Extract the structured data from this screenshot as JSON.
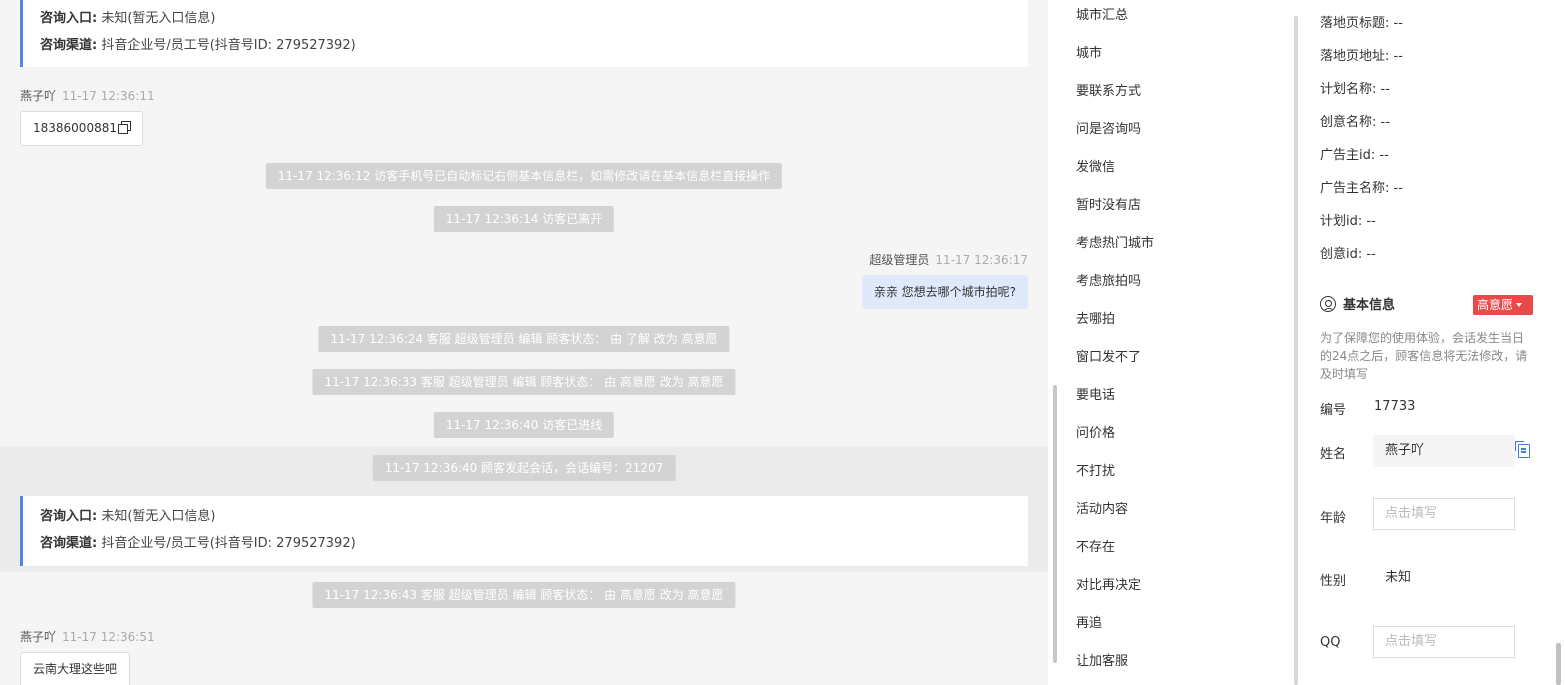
{
  "chat": {
    "info_card_1": {
      "entry_label": "咨询入口:",
      "entry_value": "未知(暂无入口信息)",
      "channel_label": "咨询渠道:",
      "channel_value": "抖音企业号/员工号(抖音号ID: 279527392)"
    },
    "msg_1": {
      "sender": "燕子吖",
      "time": "11-17 12:36:11",
      "text": "18386000881"
    },
    "sys_1": "11-17 12:36:12 访客手机号已自动标记右侧基本信息栏，如需修改请在基本信息栏直接操作",
    "sys_2": "11-17 12:36:14 访客已离开",
    "msg_agent": {
      "sender": "超级管理员",
      "time": "11-17 12:36:17",
      "text": "亲亲 您想去哪个城市拍呢?"
    },
    "sys_3": "11-17 12:36:24 客服 超级管理员 编辑 顾客状态： 由 了解 改为 高意愿",
    "sys_4": "11-17 12:36:33 客服 超级管理员 编辑 顾客状态： 由 高意愿 改为 高意愿",
    "sys_5": "11-17 12:36:40 访客已进线",
    "sys_6": "11-17 12:36:40 顾客发起会话，会话编号：21207",
    "info_card_2": {
      "entry_label": "咨询入口:",
      "entry_value": "未知(暂无入口信息)",
      "channel_label": "咨询渠道:",
      "channel_value": "抖音企业号/员工号(抖音号ID: 279527392)"
    },
    "sys_7": "11-17 12:36:43 客服 超级管理员 编辑 顾客状态： 由 高意愿 改为 高意愿",
    "msg_2": {
      "sender": "燕子吖",
      "time": "11-17 12:36:51",
      "text": "云南大理这些吧"
    }
  },
  "quick_replies": [
    "城市汇总",
    "城市",
    "要联系方式",
    "问是咨询吗",
    "发微信",
    "暂时没有店",
    "考虑热门城市",
    "考虑旅拍吗",
    "去哪拍",
    "窗口发不了",
    "要电话",
    "问价格",
    "不打扰",
    "活动内容",
    "不存在",
    "对比再决定",
    "再追",
    "让加客服"
  ],
  "ad_info": [
    {
      "label": "落地页标题:",
      "value": "--"
    },
    {
      "label": "落地页地址:",
      "value": "--"
    },
    {
      "label": "计划名称:",
      "value": "--"
    },
    {
      "label": "创意名称:",
      "value": "--"
    },
    {
      "label": "广告主id:",
      "value": "--"
    },
    {
      "label": "广告主名称:",
      "value": "--"
    },
    {
      "label": "计划id:",
      "value": "--"
    },
    {
      "label": "创意id:",
      "value": "--"
    }
  ],
  "basic_info": {
    "title": "基本信息",
    "intent_badge": "高意愿",
    "notice": "为了保障您的使用体验，会话发生当日的24点之后，顾客信息将无法修改，请及时填写",
    "id_label": "编号",
    "id_value": "17733",
    "name_label": "姓名",
    "name_value": "燕子吖",
    "age_label": "年龄",
    "age_placeholder": "点击填写",
    "gender_label": "性别",
    "gender_value": "未知",
    "qq_label": "QQ",
    "qq_placeholder": "点击填写"
  },
  "colors": {
    "accent": "#4e86e4",
    "badge": "#e84a4a",
    "agent_bubble": "#dfe9fb",
    "system_msg": "#d3d3d3"
  }
}
